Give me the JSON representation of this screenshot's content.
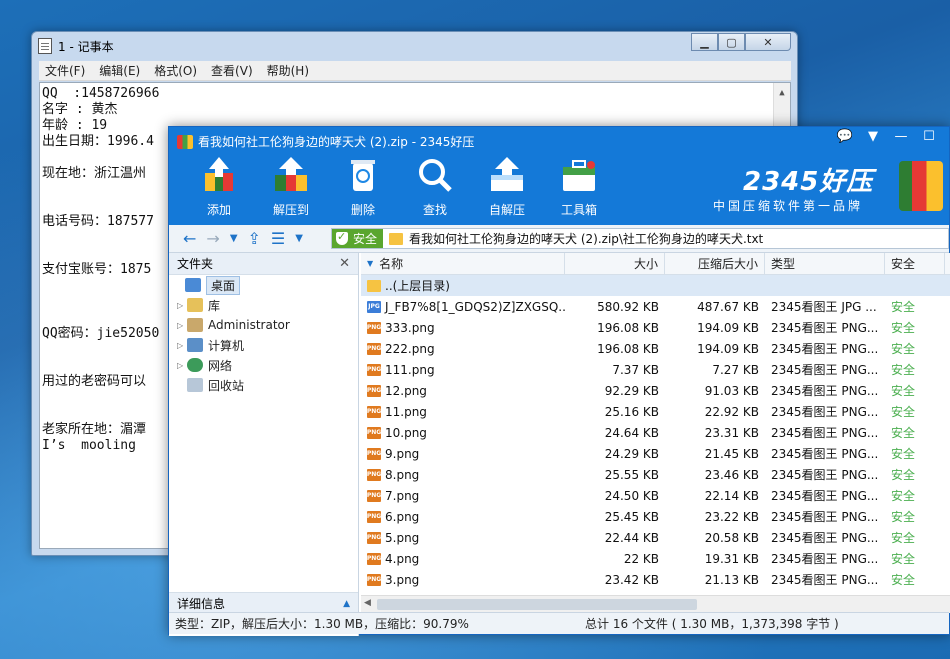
{
  "notepad": {
    "title": "1 - 记事本",
    "menu": [
      "文件(F)",
      "编辑(E)",
      "格式(O)",
      "查看(V)",
      "帮助(H)"
    ],
    "lines": [
      "QQ  :1458726966",
      "名字 : 黄杰",
      "年龄 : 19",
      "出生日期：1996.4",
      "",
      "现在地：浙江温州",
      "",
      "",
      "电话号码：187577",
      "",
      "",
      "支付宝账号：1875",
      "",
      "",
      "",
      "QQ密码：jie52050",
      "",
      "",
      "用过的老密码可以",
      "",
      "",
      "老家所在地：湄潭",
      "I’s  mooling"
    ]
  },
  "archiver": {
    "title": "看我如何社工伦狗身边的哮天犬 (2).zip - 2345好压",
    "toolbar": [
      {
        "label": "添加",
        "icon": "add-icon"
      },
      {
        "label": "解压到",
        "icon": "extract-to-icon"
      },
      {
        "label": "删除",
        "icon": "delete-icon"
      },
      {
        "label": "查找",
        "icon": "search-icon"
      },
      {
        "label": "自解压",
        "icon": "self-extract-icon"
      },
      {
        "label": "工具箱",
        "icon": "toolbox-icon"
      }
    ],
    "brand": {
      "name": "2345好压",
      "slogan": "中国压缩软件第一品牌"
    },
    "address": {
      "safe_label": "安全",
      "path": "看我如何社工伦狗身边的哮天犬 (2).zip\\社工伦狗身边的哮天犬.txt"
    },
    "tree": {
      "header": "文件夹",
      "nodes": [
        {
          "label": "桌面",
          "selected": true
        },
        {
          "label": "库"
        },
        {
          "label": "Administrator"
        },
        {
          "label": "计算机"
        },
        {
          "label": "网络"
        },
        {
          "label": "回收站"
        }
      ],
      "footer": "详细信息"
    },
    "columns": {
      "name": "名称",
      "size": "大小",
      "compressed": "压缩后大小",
      "type": "类型",
      "safe": "安全"
    },
    "up_row": "..(上层目录)",
    "files": [
      {
        "name": "J_FB7%8[1_GDQS2)Z]ZXGSQ...",
        "size": "580.92 KB",
        "compressed": "487.67 KB",
        "type": "2345看图王 JPG ...",
        "safe": "安全",
        "kind": "JPG"
      },
      {
        "name": "333.png",
        "size": "196.08 KB",
        "compressed": "194.09 KB",
        "type": "2345看图王 PNG...",
        "safe": "安全",
        "kind": "PNG"
      },
      {
        "name": "222.png",
        "size": "196.08 KB",
        "compressed": "194.09 KB",
        "type": "2345看图王 PNG...",
        "safe": "安全",
        "kind": "PNG"
      },
      {
        "name": "111.png",
        "size": "7.37 KB",
        "compressed": "7.27 KB",
        "type": "2345看图王 PNG...",
        "safe": "安全",
        "kind": "PNG"
      },
      {
        "name": "12.png",
        "size": "92.29 KB",
        "compressed": "91.03 KB",
        "type": "2345看图王 PNG...",
        "safe": "安全",
        "kind": "PNG"
      },
      {
        "name": "11.png",
        "size": "25.16 KB",
        "compressed": "22.92 KB",
        "type": "2345看图王 PNG...",
        "safe": "安全",
        "kind": "PNG"
      },
      {
        "name": "10.png",
        "size": "24.64 KB",
        "compressed": "23.31 KB",
        "type": "2345看图王 PNG...",
        "safe": "安全",
        "kind": "PNG"
      },
      {
        "name": "9.png",
        "size": "24.29 KB",
        "compressed": "21.45 KB",
        "type": "2345看图王 PNG...",
        "safe": "安全",
        "kind": "PNG"
      },
      {
        "name": "8.png",
        "size": "25.55 KB",
        "compressed": "23.46 KB",
        "type": "2345看图王 PNG...",
        "safe": "安全",
        "kind": "PNG"
      },
      {
        "name": "7.png",
        "size": "24.50 KB",
        "compressed": "22.14 KB",
        "type": "2345看图王 PNG...",
        "safe": "安全",
        "kind": "PNG"
      },
      {
        "name": "6.png",
        "size": "25.45 KB",
        "compressed": "23.22 KB",
        "type": "2345看图王 PNG...",
        "safe": "安全",
        "kind": "PNG"
      },
      {
        "name": "5.png",
        "size": "22.44 KB",
        "compressed": "20.58 KB",
        "type": "2345看图王 PNG...",
        "safe": "安全",
        "kind": "PNG"
      },
      {
        "name": "4.png",
        "size": "22 KB",
        "compressed": "19.31 KB",
        "type": "2345看图王 PNG...",
        "safe": "安全",
        "kind": "PNG"
      },
      {
        "name": "3.png",
        "size": "23.42 KB",
        "compressed": "21.13 KB",
        "type": "2345看图王 PNG...",
        "safe": "安全",
        "kind": "PNG"
      }
    ],
    "status": {
      "left": "类型：ZIP，解压后大小：1.30 MB，压缩比：90.79%",
      "right": "总计 16 个文件 ( 1.30 MB，1,373,398 字节 )"
    }
  }
}
